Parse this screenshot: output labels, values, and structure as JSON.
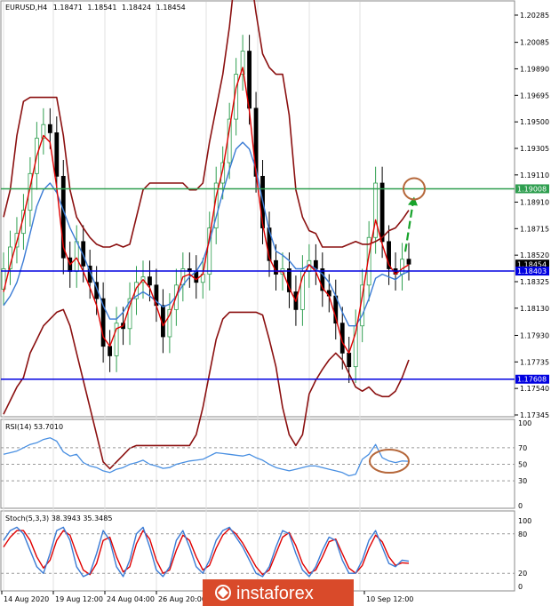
{
  "chart_data": {
    "type": "line",
    "symbol": "EURUSD,H4",
    "ohlc": [
      "1.18471",
      "1.18541",
      "1.18424",
      "1.18454"
    ],
    "y_ticks": [
      "1.20285",
      "1.20085",
      "1.19890",
      "1.19695",
      "1.19500",
      "1.19305",
      "1.19110",
      "1.18910",
      "1.18715",
      "1.18520",
      "1.18325",
      "1.18130",
      "1.17930",
      "1.17735",
      "1.17540",
      "1.17345"
    ],
    "ylim": [
      1.17345,
      1.20285
    ],
    "x_labels": [
      "14 Aug 2020",
      "19 Aug 12:00",
      "24 Aug 04:00",
      "26 Aug 20:00",
      "10 Sep 12:00"
    ],
    "levels": [
      {
        "name": "resistance",
        "value": 1.19008,
        "label": "1.19008",
        "color": "#2e9e4f"
      },
      {
        "name": "current",
        "value": 1.18454,
        "label": "1.18454",
        "color": "#000000"
      },
      {
        "name": "support-upper",
        "value": 1.18403,
        "label": "1.18403",
        "color": "#0000e0"
      },
      {
        "name": "support-lower",
        "value": 1.17608,
        "label": "1.17608",
        "color": "#0000e0"
      }
    ],
    "close": [
      1.1842,
      1.1858,
      1.1868,
      1.1885,
      1.1912,
      1.1938,
      1.1948,
      1.1942,
      1.191,
      1.185,
      1.184,
      1.1862,
      1.1844,
      1.1832,
      1.182,
      1.1785,
      1.1778,
      1.1802,
      1.1798,
      1.182,
      1.1832,
      1.1836,
      1.183,
      1.1815,
      1.1792,
      1.1812,
      1.183,
      1.1842,
      1.184,
      1.1832,
      1.1838,
      1.1872,
      1.1905,
      1.192,
      1.1952,
      1.1985,
      1.2002,
      1.196,
      1.191,
      1.1872,
      1.1848,
      1.1838,
      1.1842,
      1.1825,
      1.1812,
      1.184,
      1.1848,
      1.1842,
      1.1826,
      1.1822,
      1.1802,
      1.178,
      1.177,
      1.18,
      1.183,
      1.1865,
      1.1905,
      1.1862,
      1.1842,
      1.1838,
      1.1849,
      1.18454
    ],
    "ma_fast": [
      1.1825,
      1.1845,
      1.1862,
      1.188,
      1.1902,
      1.1925,
      1.194,
      1.1935,
      1.1902,
      1.1858,
      1.1845,
      1.185,
      1.184,
      1.1828,
      1.1815,
      1.1792,
      1.1785,
      1.1798,
      1.18,
      1.1815,
      1.1828,
      1.1834,
      1.1828,
      1.1815,
      1.18,
      1.1808,
      1.1822,
      1.1836,
      1.1838,
      1.1834,
      1.1838,
      1.1865,
      1.1895,
      1.1915,
      1.1945,
      1.1975,
      1.199,
      1.1958,
      1.1912,
      1.1875,
      1.185,
      1.184,
      1.184,
      1.1828,
      1.1818,
      1.1836,
      1.1845,
      1.184,
      1.1828,
      1.1822,
      1.1806,
      1.1788,
      1.178,
      1.1795,
      1.1822,
      1.1852,
      1.1878,
      1.186,
      1.1845,
      1.1838,
      1.1842,
      1.1845
    ],
    "ma_slow": [
      1.1815,
      1.1822,
      1.1832,
      1.1848,
      1.1868,
      1.1888,
      1.19,
      1.1905,
      1.1898,
      1.1885,
      1.1872,
      1.1862,
      1.1852,
      1.184,
      1.1828,
      1.1815,
      1.1805,
      1.1805,
      1.181,
      1.1818,
      1.1822,
      1.1825,
      1.1822,
      1.1818,
      1.1814,
      1.1816,
      1.1822,
      1.183,
      1.1836,
      1.184,
      1.1848,
      1.1862,
      1.188,
      1.1898,
      1.1915,
      1.193,
      1.1935,
      1.193,
      1.1915,
      1.1892,
      1.187,
      1.1855,
      1.1852,
      1.1848,
      1.1842,
      1.1842,
      1.1845,
      1.1842,
      1.1838,
      1.1832,
      1.1822,
      1.181,
      1.18,
      1.18,
      1.1808,
      1.182,
      1.1835,
      1.1838,
      1.1836,
      1.1834,
      1.1838,
      1.184
    ],
    "band_upper": [
      1.188,
      1.19,
      1.194,
      1.1965,
      1.1968,
      1.1968,
      1.1968,
      1.1968,
      1.1968,
      1.194,
      1.19,
      1.188,
      1.1872,
      1.1865,
      1.186,
      1.1858,
      1.1858,
      1.186,
      1.1858,
      1.186,
      1.188,
      1.19,
      1.1905,
      1.1905,
      1.1905,
      1.1905,
      1.1905,
      1.1905,
      1.19,
      1.19,
      1.1905,
      1.1935,
      1.196,
      1.1985,
      1.202,
      1.2065,
      1.208,
      1.2065,
      1.203,
      1.2,
      1.199,
      1.1985,
      1.1985,
      1.1955,
      1.19,
      1.188,
      1.187,
      1.1868,
      1.1858,
      1.1858,
      1.1858,
      1.1858,
      1.186,
      1.1862,
      1.186,
      1.186,
      1.1862,
      1.1865,
      1.187,
      1.1872,
      1.1878,
      1.1885
    ],
    "band_lower": [
      1.1735,
      1.1745,
      1.1755,
      1.1762,
      1.178,
      1.179,
      1.18,
      1.1805,
      1.181,
      1.1812,
      1.18,
      1.178,
      1.176,
      1.174,
      1.172,
      1.17,
      1.1695,
      1.17,
      1.1705,
      1.171,
      1.1712,
      1.1712,
      1.1712,
      1.1712,
      1.1712,
      1.1712,
      1.1712,
      1.1712,
      1.1712,
      1.172,
      1.174,
      1.1765,
      1.179,
      1.1805,
      1.181,
      1.181,
      1.181,
      1.181,
      1.181,
      1.1808,
      1.179,
      1.177,
      1.174,
      1.172,
      1.1712,
      1.172,
      1.175,
      1.176,
      1.1768,
      1.1775,
      1.178,
      1.1775,
      1.1765,
      1.1755,
      1.1752,
      1.1755,
      1.175,
      1.1748,
      1.1748,
      1.1752,
      1.1762,
      1.1775
    ],
    "projection": {
      "from": 1.18454,
      "to": 1.19008
    },
    "rsi": {
      "label": "RSI(14) 53.7010",
      "value": 53.701,
      "levels": [
        70,
        50,
        30
      ],
      "ticks": [
        "100",
        "70",
        "50",
        "30",
        "0"
      ],
      "ylim": [
        0,
        100
      ],
      "values": [
        62,
        64,
        66,
        70,
        74,
        76,
        80,
        82,
        78,
        65,
        60,
        62,
        52,
        48,
        46,
        42,
        40,
        44,
        46,
        50,
        52,
        55,
        50,
        48,
        45,
        46,
        50,
        52,
        54,
        55,
        56,
        60,
        64,
        63,
        62,
        61,
        60,
        62,
        58,
        55,
        50,
        46,
        44,
        42,
        44,
        46,
        48,
        48,
        46,
        44,
        42,
        40,
        36,
        38,
        56,
        62,
        74,
        58,
        54,
        52,
        54,
        53.7
      ]
    },
    "stoch": {
      "label": "Stoch(5,3,3) 38.3943 35.3485",
      "main": 38.3943,
      "signal": 35.3485,
      "levels": [
        80,
        20
      ],
      "ticks": [
        "100",
        "80",
        "20",
        "0"
      ],
      "ylim": [
        0,
        100
      ],
      "main_values": [
        70,
        85,
        90,
        80,
        55,
        30,
        20,
        50,
        85,
        90,
        70,
        30,
        15,
        20,
        50,
        85,
        70,
        30,
        15,
        40,
        80,
        90,
        60,
        25,
        15,
        30,
        70,
        85,
        60,
        30,
        20,
        40,
        70,
        85,
        90,
        75,
        60,
        40,
        20,
        15,
        30,
        60,
        85,
        80,
        50,
        25,
        15,
        30,
        55,
        75,
        70,
        40,
        20,
        20,
        40,
        70,
        85,
        60,
        35,
        30,
        40,
        38.4
      ],
      "signal_values": [
        60,
        75,
        85,
        85,
        70,
        45,
        28,
        40,
        70,
        85,
        78,
        50,
        25,
        18,
        35,
        70,
        75,
        45,
        22,
        30,
        65,
        85,
        72,
        40,
        20,
        25,
        55,
        78,
        70,
        45,
        25,
        32,
        58,
        78,
        88,
        80,
        66,
        48,
        30,
        18,
        25,
        50,
        75,
        82,
        62,
        35,
        20,
        25,
        45,
        68,
        72,
        50,
        28,
        20,
        32,
        58,
        78,
        68,
        45,
        32,
        36,
        35.3
      ]
    }
  },
  "watermark": "instaforex",
  "colors": {
    "candle_up": "#2e9e4f",
    "candle_down": "#000000",
    "ma_fast": "#e00000",
    "ma_slow": "#3a7bd5",
    "bands": "#8b1010",
    "resistance": "#2e9e4f",
    "support": "#0000e0",
    "annotation": "#b5673a",
    "projection": "#17a32b",
    "rsi": "#4a90e2",
    "stoch_main": "#3a7bd5",
    "stoch_signal": "#e00000",
    "watermark_bg": "#d94a2a"
  }
}
